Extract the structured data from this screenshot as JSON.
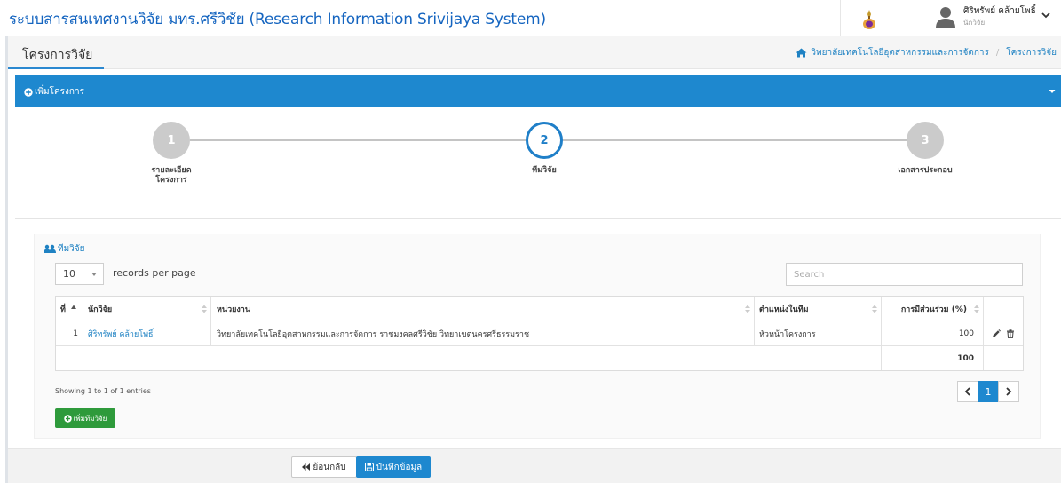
{
  "header": {
    "site_title": "ระบบสารสนเทศงานวิจัย มทร.ศรีวิชัย (Research Information Srivijaya System)",
    "user_name": "ศิริทรัพย์ คล้ายโพธิ์",
    "user_role": "นักวิจัย"
  },
  "page": {
    "title": "โครงการวิจัย",
    "breadcrumb": [
      "วิทยาลัยเทคโนโลยีอุตสาหกรรมและการจัดการ",
      "โครงการวิจัย"
    ]
  },
  "panel": {
    "title": "เพิ่มโครงการ"
  },
  "wizard": {
    "steps": [
      {
        "number": "1",
        "label": "รายละเอียด\nโครงการ",
        "state": "done"
      },
      {
        "number": "2",
        "label": "ทีมวิจัย",
        "state": "active"
      },
      {
        "number": "3",
        "label": "เอกสารประกอบ",
        "state": "pending"
      }
    ],
    "step1_label_line1": "รายละเอียด",
    "step1_label_line2": "โครงการ"
  },
  "team": {
    "title": "ทีมวิจัย",
    "length_value": "10",
    "records_per_page": "records per page",
    "search_placeholder": "Search",
    "columns": [
      "ที่",
      "นักวิจัย",
      "หน่วยงาน",
      "ตำแหน่งในทีม",
      "การมีส่วนร่วม (%)"
    ],
    "rows": [
      {
        "no": "1",
        "researcher": "ศิริทรัพย์ คล้ายโพธิ์",
        "unit": "วิทยาลัยเทคโนโลยีอุตสาหกรรมและการจัดการ ราชมงคลศรีวิชัย วิทยาเขตนครศรีธรรมราช",
        "position": "หัวหน้าโครงการ",
        "participation": "100"
      }
    ],
    "total": "100",
    "info": "Showing 1 to 1 of 1 entries",
    "current_page": "1",
    "add_label": "เพิ่มทีมวิจัย"
  },
  "actions": {
    "back_label": "ย้อนกลับ",
    "save_label": "บันทึกข้อมูล"
  },
  "colors": {
    "primary": "#1e88cf",
    "link": "#1f82c3",
    "success": "#2e9a3b",
    "step_inactive": "#cbcbcb"
  },
  "icons": [
    "emblem-icon",
    "user-avatar-icon",
    "chevron-down-icon",
    "home-icon",
    "plus-circle-icon",
    "users-icon",
    "sort-icon",
    "pencil-icon",
    "trash-icon",
    "chevron-left-icon",
    "chevron-right-icon",
    "backward-icon",
    "floppy-icon"
  ]
}
